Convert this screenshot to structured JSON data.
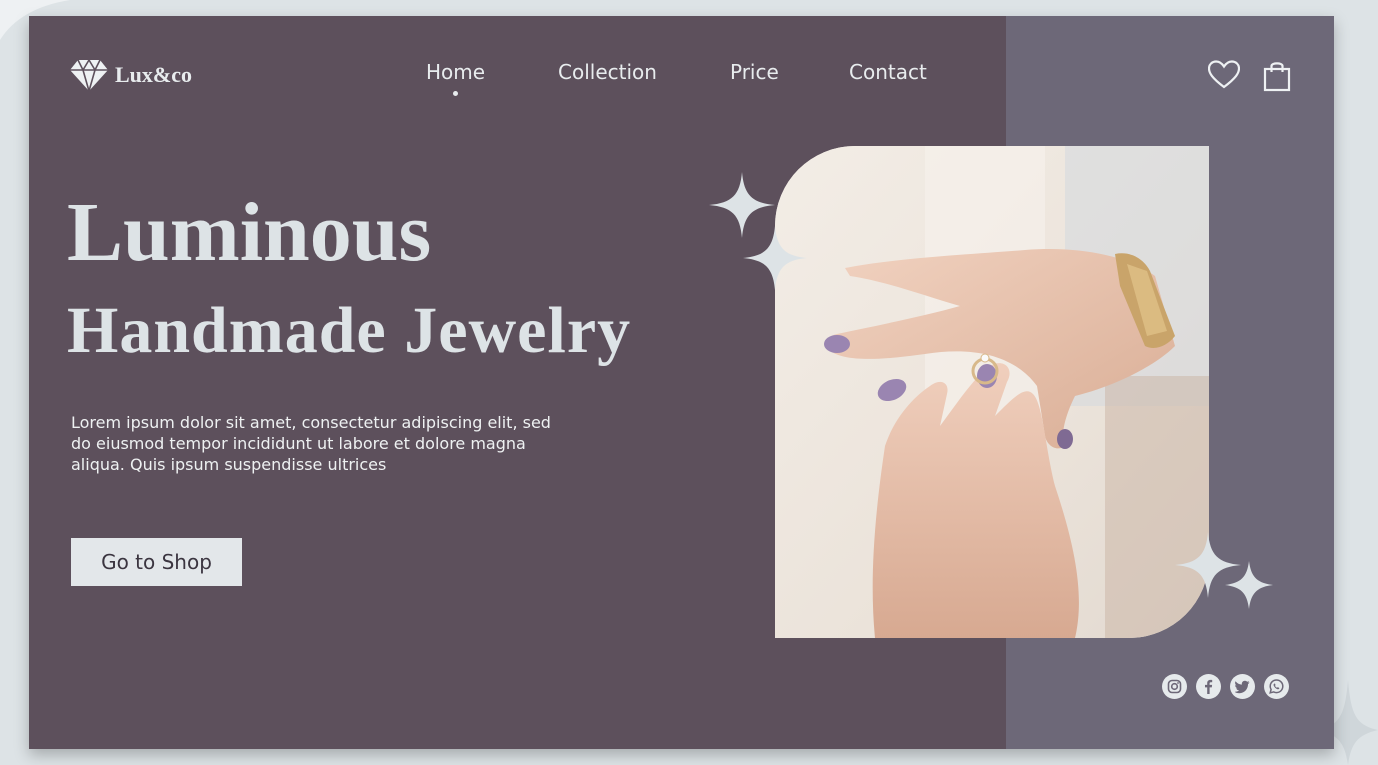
{
  "brand": {
    "name": "Lux&co",
    "logo_icon": "diamond-icon"
  },
  "nav": {
    "items": [
      {
        "label": "Home",
        "active": true
      },
      {
        "label": "Collection",
        "active": false
      },
      {
        "label": "Price",
        "active": false
      },
      {
        "label": "Contact",
        "active": false
      }
    ]
  },
  "header_icons": [
    "heart-icon",
    "shopping-bag-icon"
  ],
  "hero": {
    "title_line1": "Luminous",
    "title_line2": "Handmade Jewelry",
    "description": "Lorem ipsum dolor sit amet, consectetur adipiscing elit, sed do eiusmod tempor incididunt ut labore et dolore magna aliqua. Quis ipsum suspendisse ultrices",
    "cta_label": "Go to Shop"
  },
  "social_icons": [
    "instagram-icon",
    "facebook-icon",
    "twitter-icon",
    "whatsapp-icon"
  ],
  "colors": {
    "left_panel": "#5d505c",
    "right_panel": "#6d6878",
    "page_background": "#dde3e6",
    "text_light": "#dde3e6"
  }
}
